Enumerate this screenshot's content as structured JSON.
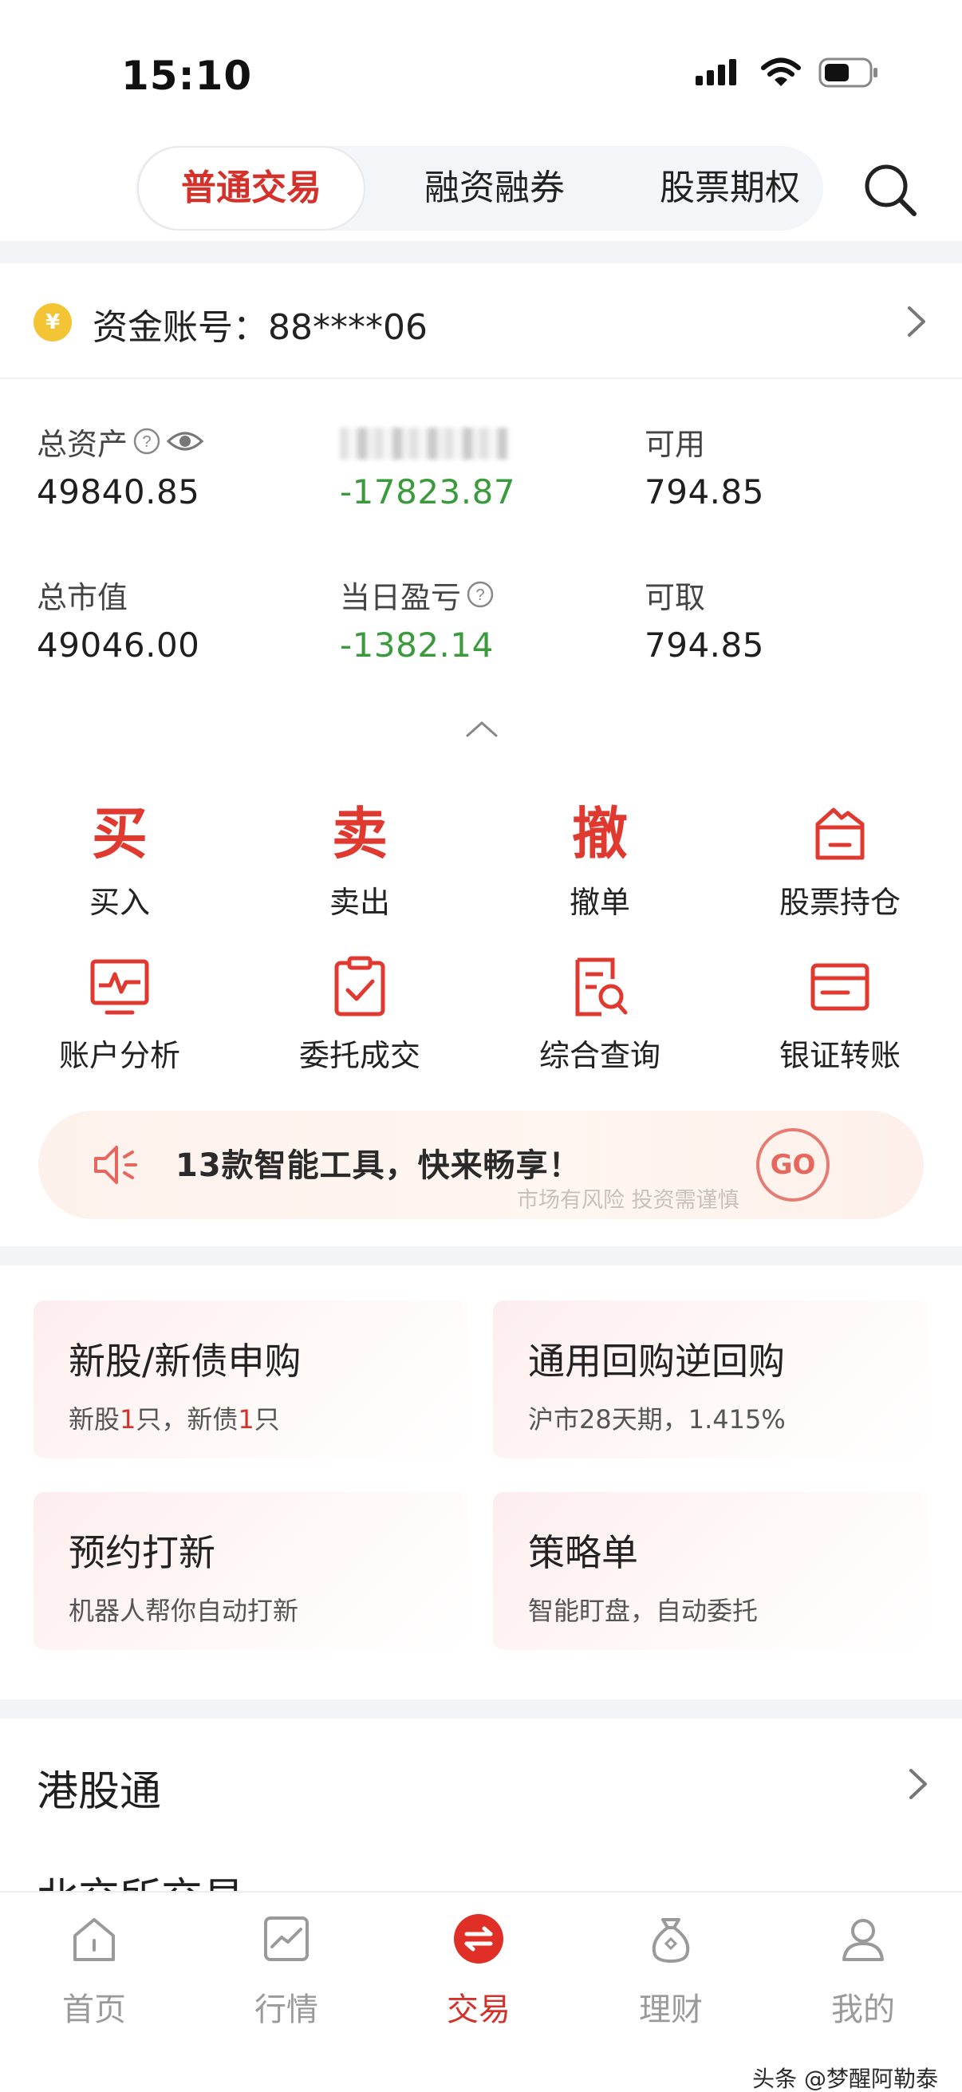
{
  "status_bar": {
    "time": "15:10"
  },
  "top_tabs": {
    "tab1": "普通交易",
    "tab2": "融资融券",
    "tab3": "股票期权"
  },
  "account": {
    "coin": "¥",
    "label": "资金账号：88****06"
  },
  "assets": {
    "total_assets_label": "总资产",
    "total_assets": "49840.85",
    "hidden_value": "-17823.87",
    "available_label": "可用",
    "available": "794.85",
    "market_value_label": "总市值",
    "market_value": "49046.00",
    "daily_pnl_label": "当日盈亏",
    "daily_pnl": "-1382.14",
    "withdrawable_label": "可取",
    "withdrawable": "794.85"
  },
  "quick_actions": {
    "buy_glyph": "买",
    "buy": "买入",
    "sell_glyph": "卖",
    "sell": "卖出",
    "cancel_glyph": "撤",
    "cancel": "撤单",
    "positions": "股票持仓",
    "analysis": "账户分析",
    "orders": "委托成交",
    "query": "综合查询",
    "transfer": "银证转账"
  },
  "promo": {
    "text": "13款智能工具，快来畅享！",
    "disclaimer": "市场有风险 投资需谨慎",
    "go": "GO"
  },
  "cards": {
    "ipo_title": "新股/新债申购",
    "ipo_sub_1": "新股",
    "ipo_sub_n1": "1",
    "ipo_sub_2": "只，新债",
    "ipo_sub_n2": "1",
    "ipo_sub_3": "只",
    "repo_title": "通用回购逆回购",
    "repo_sub": "沪市28天期，1.415%",
    "reserve_title": "预约打新",
    "reserve_sub": "机器人帮你自动打新",
    "strategy_title": "策略单",
    "strategy_sub": "智能盯盘，自动委托"
  },
  "hk_connect": {
    "title": "港股通"
  },
  "next_section": {
    "title": "北交所交易"
  },
  "bottom_nav": {
    "home": "首页",
    "market": "行情",
    "trade": "交易",
    "wealth": "理财",
    "mine": "我的"
  },
  "watermark": "头条 @梦醒阿勒泰",
  "colors": {
    "accent": "#d4312a",
    "negative": "#3a9b3c",
    "coin": "#f3c433"
  }
}
